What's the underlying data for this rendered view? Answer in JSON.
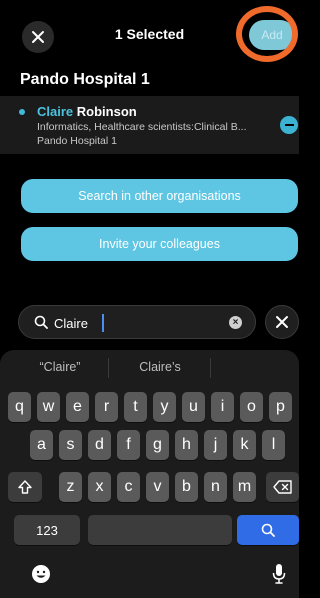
{
  "header": {
    "title": "1 Selected",
    "add_label": "Add"
  },
  "organisation": {
    "title": "Pando Hospital 1"
  },
  "selected_contact": {
    "first_name": "Claire",
    "last_name": "Robinson",
    "role": "Informatics, Healthcare scientists:Clinical B...",
    "organisation": "Pando Hospital 1"
  },
  "actions": {
    "search_other_orgs": "Search in other organisations",
    "invite_colleagues": "Invite your colleagues"
  },
  "search": {
    "value": "Claire"
  },
  "keyboard": {
    "suggestions": [
      "“Claire”",
      "Claire’s"
    ],
    "row1": [
      "q",
      "w",
      "e",
      "r",
      "t",
      "y",
      "u",
      "i",
      "o",
      "p"
    ],
    "row2": [
      "a",
      "s",
      "d",
      "f",
      "g",
      "h",
      "j",
      "k",
      "l"
    ],
    "row3": [
      "z",
      "x",
      "c",
      "v",
      "b",
      "n",
      "m"
    ],
    "numbers_label": "123",
    "colors": {
      "accent": "#2f6ce5"
    }
  },
  "colors": {
    "brand": "#5ec6e3",
    "highlight_ring": "#ef6a2b"
  },
  "icons": [
    "close-icon",
    "minus-icon",
    "search-icon",
    "clear-icon",
    "shift-icon",
    "backspace-icon",
    "emoji-icon",
    "microphone-icon"
  ]
}
